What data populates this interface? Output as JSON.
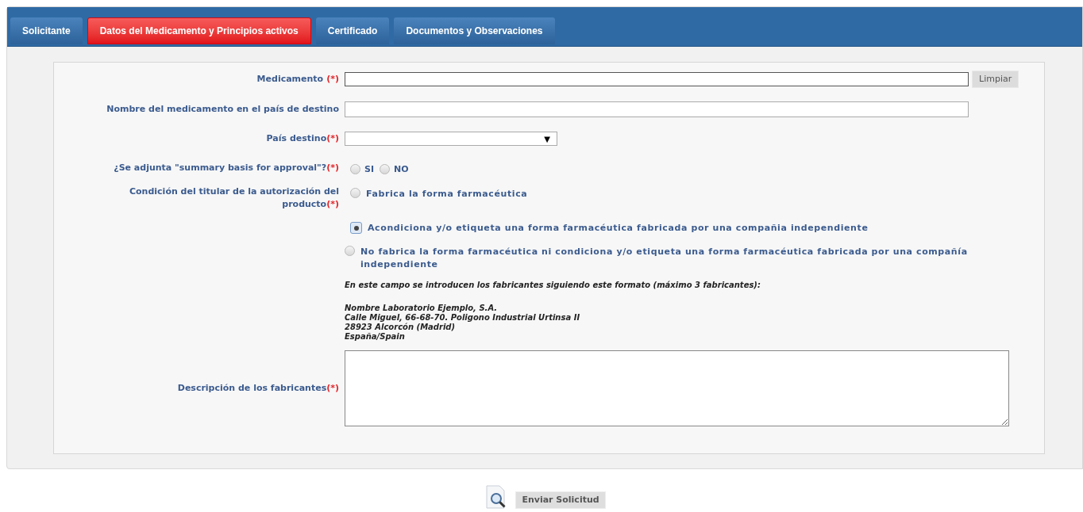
{
  "tabs": [
    {
      "label": "Solicitante",
      "selected": false
    },
    {
      "label": "Datos del Medicamento y Principios activos",
      "selected": true
    },
    {
      "label": "Certificado",
      "selected": false
    },
    {
      "label": "Documentos y Observaciones",
      "selected": false
    }
  ],
  "form": {
    "fields": [
      {
        "kind": "text",
        "label": "Medicamento",
        "required_mark": "(*)",
        "mark_gap": true,
        "button": "Limpiar"
      },
      {
        "kind": "text",
        "label": "Nombre del medicamento en el país de destino"
      },
      {
        "kind": "select",
        "label": "País destino",
        "required_mark": "(*)",
        "arrow": "▼"
      },
      {
        "kind": "inline_radio",
        "label": "¿Se adjunta \"summary basis for approval\"?",
        "required_mark": "(*)",
        "options": [
          {
            "label": "SI",
            "selected": false
          },
          {
            "label": "NO",
            "selected": false
          }
        ]
      },
      {
        "kind": "stacked_radio",
        "label": "Condición del titular de la autorización del producto",
        "required_mark": "(*)",
        "options": [
          {
            "label": "Fabrica la forma farmacéutica",
            "selected": false
          },
          {
            "label": "Acondiciona y/o etiqueta una forma farmacéutica fabricada por una compañia independiente",
            "selected": true
          },
          {
            "label": "No fabrica la forma farmacéutica ni condiciona y/o etiqueta una forma farmacéutica fabricada por una compañía independiente",
            "selected": false
          }
        ]
      },
      {
        "kind": "note",
        "text": "En este campo se introducen los fabricantes siguiendo este formato (máximo 3 fabricantes):",
        "example_lines": [
          "Nombre Laboratorio Ejemplo, S.A.",
          "Calle Miguel, 66-68-70. Poligono Industrial Urtinsa II",
          "28923 Alcorcón (Madrid)",
          "España/Spain"
        ]
      },
      {
        "kind": "textarea",
        "label": "Descripción de los fabricantes",
        "required_mark": "(*)"
      }
    ]
  },
  "submit": {
    "label": "Enviar Solicitud"
  }
}
